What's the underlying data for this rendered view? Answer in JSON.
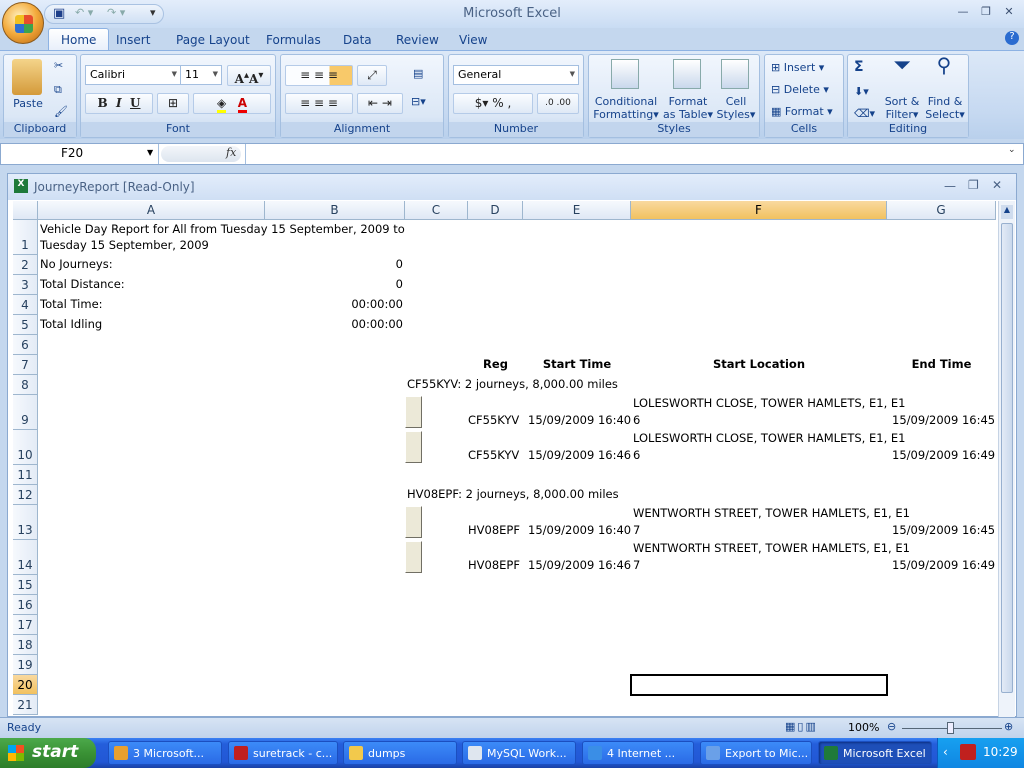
{
  "app": {
    "title": "Microsoft Excel"
  },
  "ribbon": {
    "tabs": [
      "Home",
      "Insert",
      "Page Layout",
      "Formulas",
      "Data",
      "Review",
      "View"
    ],
    "clipboard": {
      "label": "Clipboard",
      "paste": "Paste"
    },
    "font": {
      "label": "Font",
      "name": "Calibri",
      "size": "11",
      "bold": "B",
      "italic": "I",
      "underline": "U"
    },
    "alignment": {
      "label": "Alignment"
    },
    "number": {
      "label": "Number",
      "format": "General",
      "percent": "%",
      "comma": ","
    },
    "styles": {
      "label": "Styles",
      "conditional": "Conditional",
      "conditional2": "Formatting",
      "format_table": "Format",
      "format_table2": "as Table",
      "cell_styles": "Cell",
      "cell_styles2": "Styles"
    },
    "cells": {
      "label": "Cells",
      "insert": "Insert",
      "delete": "Delete",
      "format": "Format"
    },
    "editing": {
      "label": "Editing",
      "sort": "Sort &",
      "sort2": "Filter",
      "find": "Find &",
      "find2": "Select",
      "sigma": "Σ"
    }
  },
  "formula_bar": {
    "name_box": "F20",
    "fx": "fx",
    "value": ""
  },
  "workbook": {
    "title": "JourneyReport  [Read-Only]"
  },
  "sheet": {
    "columns": [
      "A",
      "B",
      "C",
      "D",
      "E",
      "F",
      "G"
    ],
    "selected_cell": "F20",
    "rows": [
      "1",
      "2",
      "3",
      "4",
      "5",
      "6",
      "7",
      "8",
      "9",
      "10",
      "11",
      "12",
      "13",
      "14",
      "15",
      "16",
      "17",
      "18",
      "19",
      "20",
      "21"
    ],
    "title_line1": "Vehicle Day Report for All from Tuesday 15 September, 2009 to",
    "title_line2": "Tuesday 15 September, 2009",
    "summary": [
      {
        "label": "No Journeys:",
        "value": "0"
      },
      {
        "label": "Total Distance:",
        "value": "0"
      },
      {
        "label": "Total Time:",
        "value": "00:00:00"
      },
      {
        "label": "Total Idling",
        "value": "00:00:00"
      }
    ],
    "headers": {
      "reg": "Reg",
      "start_time": "Start Time",
      "start_location": "Start Location",
      "end_time": "End Time"
    },
    "groups": [
      {
        "title": "CF55KYV: 2 journeys, 8,000.00 miles",
        "journeys": [
          {
            "reg": "CF55KYV",
            "start": "15/09/2009 16:40",
            "loc1": "LOLESWORTH CLOSE, TOWER HAMLETS, E1, E1",
            "loc2": "6",
            "end": "15/09/2009 16:45"
          },
          {
            "reg": "CF55KYV",
            "start": "15/09/2009 16:46",
            "loc1": "LOLESWORTH CLOSE, TOWER HAMLETS, E1, E1",
            "loc2": "6",
            "end": "15/09/2009 16:49"
          }
        ]
      },
      {
        "title": "HV08EPF: 2 journeys, 8,000.00 miles",
        "journeys": [
          {
            "reg": "HV08EPF",
            "start": "15/09/2009 16:40",
            "loc1": "WENTWORTH STREET, TOWER HAMLETS, E1, E1",
            "loc2": "7",
            "end": "15/09/2009 16:45"
          },
          {
            "reg": "HV08EPF",
            "start": "15/09/2009 16:46",
            "loc1": "WENTWORTH STREET, TOWER HAMLETS, E1, E1",
            "loc2": "7",
            "end": "15/09/2009 16:49"
          }
        ]
      }
    ]
  },
  "status": {
    "text": "Ready",
    "zoom": "100%"
  },
  "taskbar": {
    "start": "start",
    "clock": "10:29",
    "items": [
      {
        "label": "3 Microsoft...",
        "color": "#e8a030"
      },
      {
        "label": "suretrack - c...",
        "color": "#c0201e"
      },
      {
        "label": "dumps",
        "color": "#f2c94c"
      },
      {
        "label": "MySQL Work...",
        "color": "#dfe6ef"
      },
      {
        "label": "4 Internet ...",
        "color": "#3a8ee6"
      },
      {
        "label": "Export to Mic...",
        "color": "#6aa0e8"
      },
      {
        "label": "Microsoft Excel",
        "color": "#1f7a3a"
      }
    ]
  }
}
